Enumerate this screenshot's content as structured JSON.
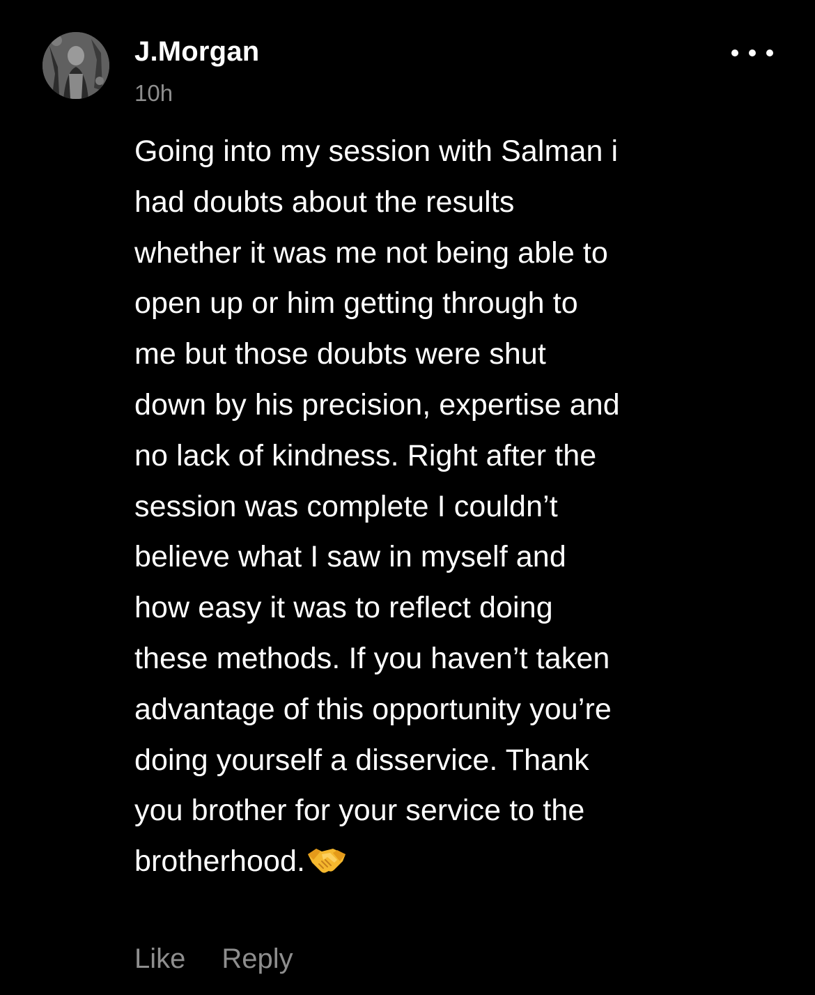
{
  "comment": {
    "author": "J.Morgan",
    "timestamp": "10h",
    "avatar_icon": "profile-photo",
    "more_icon": "more-horizontal-icon",
    "text": "Going into my session with Salman i\nhad doubts about the results\nwhether it was me not being able to\nopen up or him getting through to\nme but those doubts were shut\ndown by his precision, expertise and\nno lack of kindness. Right after the\nsession was complete I couldn’t\nbelieve what I saw in myself and\nhow easy it was to reflect doing\nthese methods. If you haven’t taken\nadvantage of this opportunity you’re\ndoing yourself a disservice. Thank\nyou brother for your service to the\nbrotherhood.",
    "emoji_icon": "handshake-emoji-icon"
  },
  "actions": {
    "like_label": "Like",
    "reply_label": "Reply"
  },
  "colors": {
    "background": "#000000",
    "primary_text": "#ffffff",
    "secondary_text": "#8e8e8e",
    "emoji": "#f5b82e"
  }
}
